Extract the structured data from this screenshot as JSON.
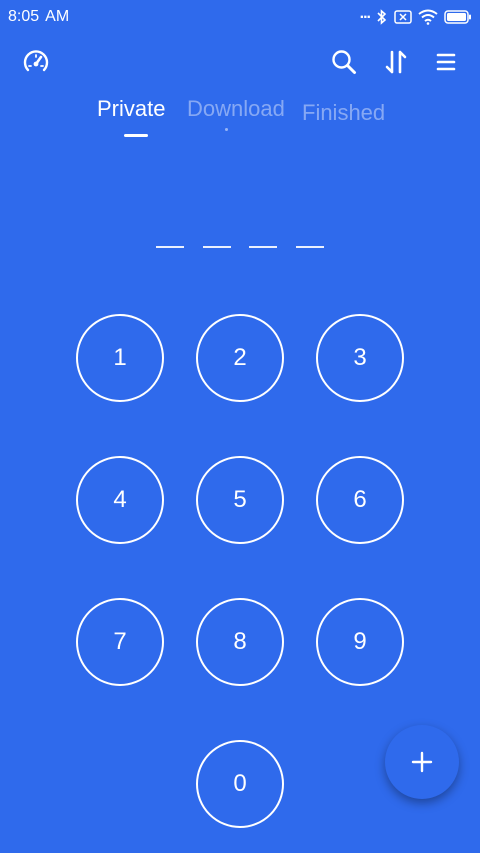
{
  "status_bar": {
    "time": "8:05",
    "ampm": "AM",
    "more": "...",
    "icons": [
      "bluetooth-icon",
      "sim-off-icon",
      "wifi-icon",
      "battery-icon"
    ]
  },
  "toolbar": {
    "left_icon": "speedometer-icon",
    "right_icons": [
      "search-icon",
      "sort-icon",
      "menu-icon"
    ]
  },
  "tabs": [
    {
      "label": "Private",
      "active": true
    },
    {
      "label": "Download",
      "active": false
    },
    {
      "label": "Finished",
      "active": false
    }
  ],
  "pin": {
    "length": 4
  },
  "keypad": {
    "keys": [
      "1",
      "2",
      "3",
      "4",
      "5",
      "6",
      "7",
      "8",
      "9",
      "0"
    ]
  },
  "fab": {
    "label": "+"
  },
  "colors": {
    "background": "#2f6aec",
    "foreground": "#ffffff"
  }
}
